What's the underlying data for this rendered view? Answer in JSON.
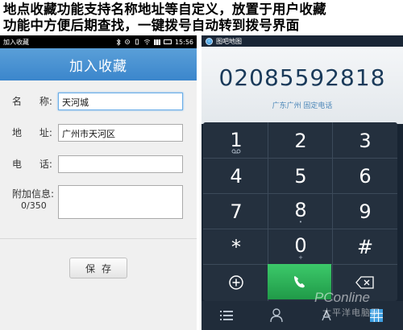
{
  "headline": {
    "line1": "地点收藏功能支持名称地址等自定义，放置于用户收藏",
    "line2": "功能中方便后期查找，一键拨号自动转到拨号界面"
  },
  "left_phone": {
    "status_bar": {
      "app_name": "加入收藏",
      "time": "15:56"
    },
    "title": "加入收藏",
    "form": {
      "name_label": [
        "名",
        "称:"
      ],
      "name_value": "天河城",
      "address_label": [
        "地",
        "址:"
      ],
      "address_value": "广州市天河区",
      "phone_label": [
        "电",
        "话:"
      ],
      "phone_value": "",
      "extra_label": "附加信息:",
      "extra_counter": "0/350"
    },
    "save_label": "保存"
  },
  "right_phone": {
    "status_bar": {
      "app_name": "图吧地图"
    },
    "number": "02085592818",
    "location": "广东广州 固定电话",
    "keys": [
      {
        "digit": "1",
        "sub": "voicemail-icon"
      },
      {
        "digit": "2",
        "sub": ""
      },
      {
        "digit": "3",
        "sub": ""
      },
      {
        "digit": "4",
        "sub": ""
      },
      {
        "digit": "5",
        "sub": ""
      },
      {
        "digit": "6",
        "sub": ""
      },
      {
        "digit": "7",
        "sub": ""
      },
      {
        "digit": "8",
        "sub": "•"
      },
      {
        "digit": "9",
        "sub": ""
      },
      {
        "digit": "*",
        "sub": ""
      },
      {
        "digit": "0",
        "sub": "+"
      },
      {
        "digit": "#",
        "sub": ""
      }
    ],
    "watermark": {
      "line1": "PConline",
      "line2": "太平洋电脑网"
    },
    "colors": {
      "call_green": "#2aa854",
      "display_digits": "#1a3a5a",
      "location_blue": "#4b86b8"
    }
  }
}
